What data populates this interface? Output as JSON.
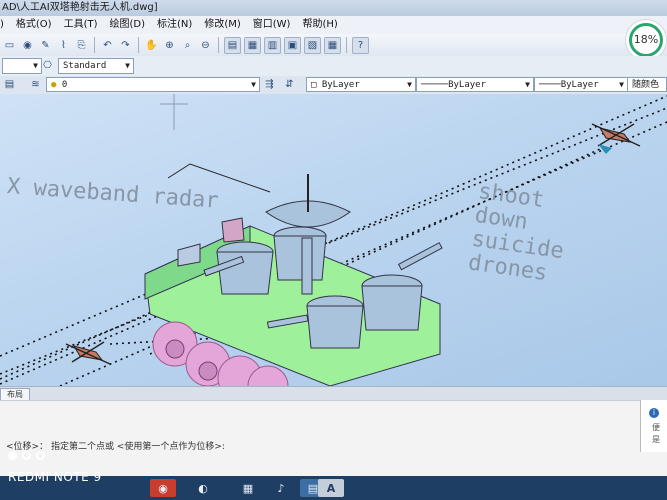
{
  "window": {
    "title": "AD\\人工AI双塔艳射击无人机.dwg]"
  },
  "menu": {
    "items": [
      ")",
      "格式(O)",
      "工具(T)",
      "绘图(D)",
      "标注(N)",
      "修改(M)",
      "窗口(W)",
      "帮助(H)"
    ]
  },
  "toolbar": {
    "icons": [
      "open-icon",
      "save-icon",
      "pencil-icon",
      "brush-icon",
      "match-properties-icon",
      "undo-icon",
      "redo-icon",
      "pan-icon",
      "zoom-realtime-icon",
      "zoom-window-icon",
      "zoom-previous-icon",
      "properties-icon",
      "design-center-icon",
      "tool-palettes-icon",
      "sheet-set-icon",
      "markup-icon",
      "calculator-icon",
      "help-icon"
    ]
  },
  "styles": {
    "text_style": "Standard"
  },
  "layers": {
    "current_layer": "0",
    "color": "ByLayer",
    "linetype": "ByLayer",
    "lineweight": "ByLayer",
    "plotstyle": "随颜色"
  },
  "drawing": {
    "annotation_left": "X waveband radar",
    "annotation_right_lines": [
      "shoot",
      "down",
      "suicide",
      "drones"
    ]
  },
  "layout": {
    "tab_label": "布局"
  },
  "command": {
    "prompt": "<位移>：  指定第二个点或  <使用第一个点作为位移>:"
  },
  "side_panel": {
    "lines": [
      "便",
      "是"
    ]
  },
  "status": {
    "progress_percent": "18%",
    "progress_fraction": 0.18,
    "accent_color": "#2aa56d"
  },
  "device": {
    "watermark": "REDMI NOTE 9"
  },
  "colors": {
    "canvas": "#bdd6f0",
    "platform": "#9ef09a",
    "dome": "#a9c3dd",
    "wheels": "#e4a6d8"
  }
}
